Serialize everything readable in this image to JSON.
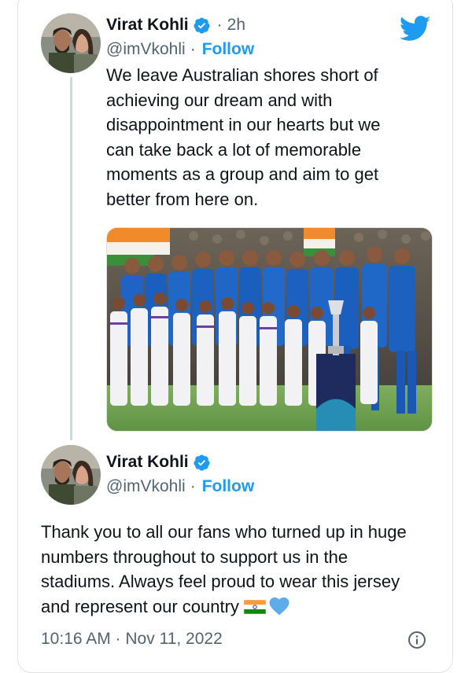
{
  "tweet1": {
    "name": "Virat Kohli",
    "time_separator": "·",
    "time": "2h",
    "handle": "@imVkohli",
    "follow_separator": "·",
    "follow_label": "Follow",
    "text_lines": [
      "We leave Australian shores short of",
      "achieving our dream and with",
      "disappointment in our hearts but we",
      "can take back a lot of memorable",
      "moments as a group and aim to get",
      "better from here on."
    ],
    "media_icon": "team-photo-national-anthem"
  },
  "tweet2": {
    "name": "Virat Kohli",
    "handle": "@imVkohli",
    "follow_separator": "·",
    "follow_label": "Follow",
    "text_lines": [
      "Thank you to all our fans who turned up in huge",
      "numbers throughout to support us in the",
      "stadiums. Always feel proud to wear this jersey",
      "and represent our country"
    ],
    "emojis": [
      "india-flag-icon",
      "blue-heart-icon"
    ],
    "timestamp": "10:16 AM · Nov 11, 2022"
  },
  "colors": {
    "accent": "#1d9bf0",
    "secondary_text": "#536471",
    "primary_text": "#0f1419",
    "border": "#dfe3e6"
  },
  "icons": {
    "logo": "twitter-bird-icon",
    "verified": "verified-badge-icon",
    "info": "info-icon"
  }
}
